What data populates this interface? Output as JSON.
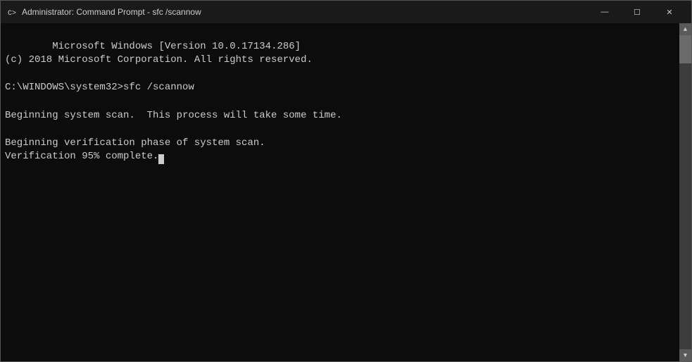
{
  "titleBar": {
    "icon": "cmd-icon",
    "title": "Administrator: Command Prompt - sfc /scannow",
    "minimizeLabel": "—",
    "maximizeLabel": "☐",
    "closeLabel": "✕"
  },
  "console": {
    "lines": [
      "Microsoft Windows [Version 10.0.17134.286]",
      "(c) 2018 Microsoft Corporation. All rights reserved.",
      "",
      "C:\\WINDOWS\\system32>sfc /scannow",
      "",
      "Beginning system scan.  This process will take some time.",
      "",
      "Beginning verification phase of system scan.",
      "Verification 95% complete."
    ],
    "cursorVisible": true
  }
}
